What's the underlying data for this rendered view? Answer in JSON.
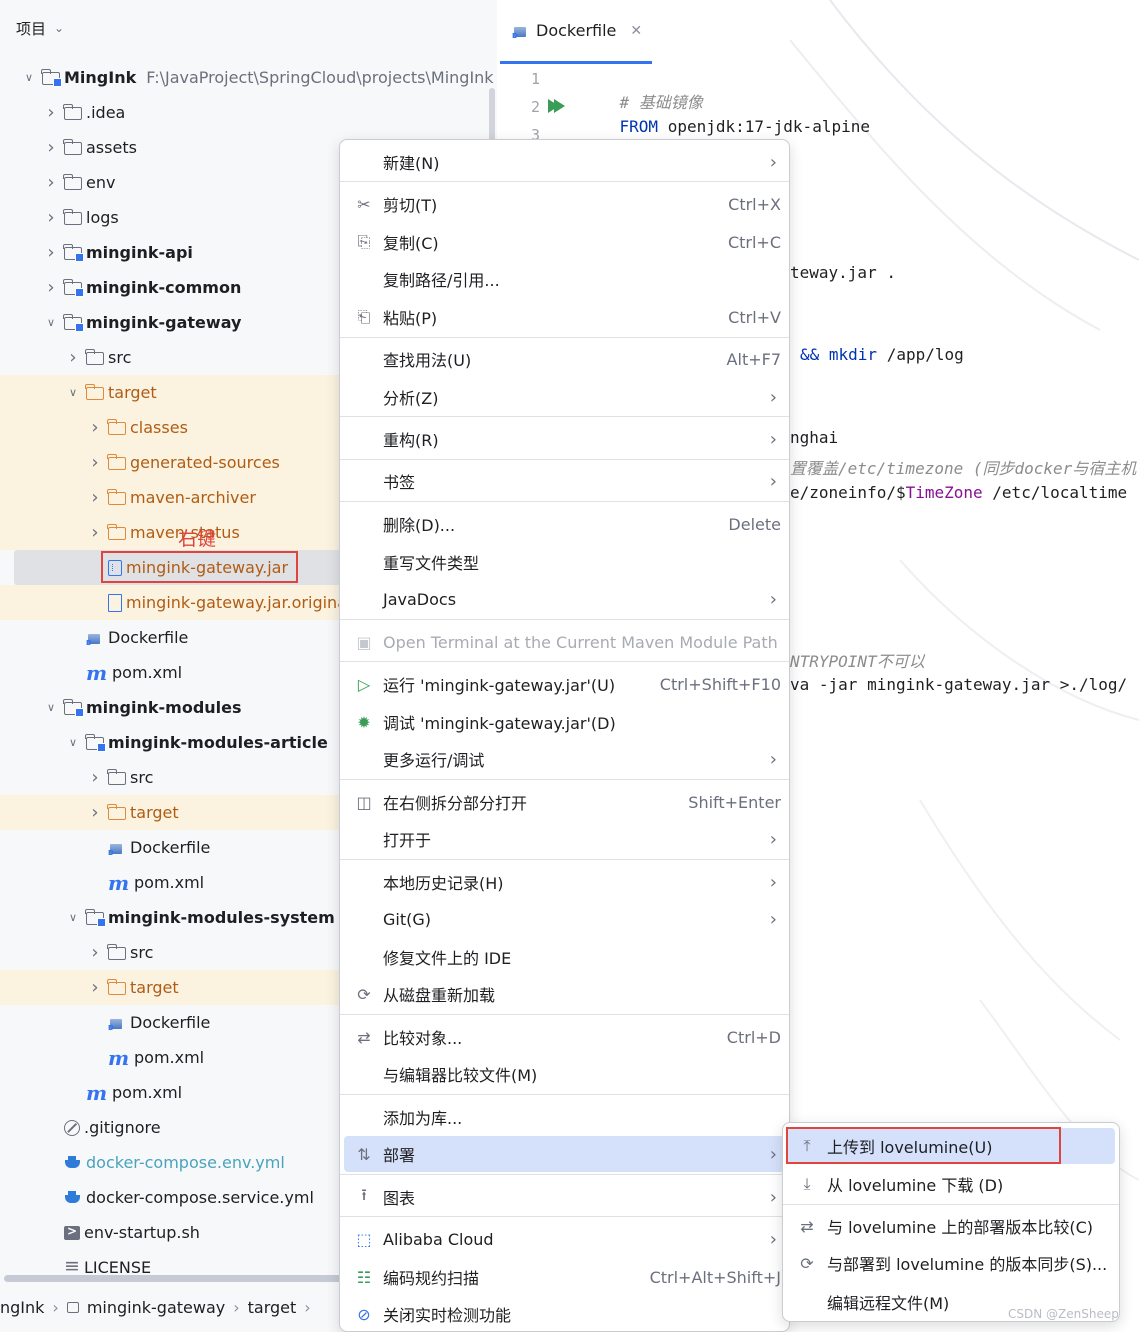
{
  "project_panel": {
    "title": "项目",
    "tree": [
      {
        "label": "MingInk",
        "path": "F:\\JavaProject\\SpringCloud\\projects\\MingInk",
        "type": "module",
        "depth": 1,
        "arrow": "open",
        "bold": true
      },
      {
        "label": ".idea",
        "type": "folder",
        "depth": 2,
        "arrow": "closed"
      },
      {
        "label": "assets",
        "type": "folder",
        "depth": 2,
        "arrow": "closed"
      },
      {
        "label": "env",
        "type": "folder",
        "depth": 2,
        "arrow": "closed"
      },
      {
        "label": "logs",
        "type": "folder",
        "depth": 2,
        "arrow": "closed"
      },
      {
        "label": "mingink-api",
        "type": "module",
        "depth": 2,
        "arrow": "closed",
        "bold": true
      },
      {
        "label": "mingink-common",
        "type": "module",
        "depth": 2,
        "arrow": "closed",
        "bold": true
      },
      {
        "label": "mingink-gateway",
        "type": "module",
        "depth": 2,
        "arrow": "open",
        "bold": true
      },
      {
        "label": "src",
        "type": "folder",
        "depth": 3,
        "arrow": "closed"
      },
      {
        "label": "target",
        "type": "folder-orange",
        "depth": 3,
        "arrow": "open",
        "excluded": true
      },
      {
        "label": "classes",
        "type": "folder-orange",
        "depth": 4,
        "arrow": "closed",
        "excluded": true
      },
      {
        "label": "generated-sources",
        "type": "folder-orange",
        "depth": 4,
        "arrow": "closed",
        "excluded": true
      },
      {
        "label": "maven-archiver",
        "type": "folder-orange",
        "depth": 4,
        "arrow": "closed",
        "excluded": true
      },
      {
        "label": "maven-status",
        "type": "folder-orange",
        "depth": 4,
        "arrow": "closed",
        "excluded": true
      },
      {
        "label": "mingink-gateway.jar",
        "type": "jar",
        "depth": 4,
        "arrow": "none",
        "excluded": true,
        "selected": true
      },
      {
        "label": "mingink-gateway.jar.original",
        "type": "file",
        "depth": 4,
        "arrow": "none",
        "excluded": true
      },
      {
        "label": "Dockerfile",
        "type": "docker",
        "depth": 3,
        "arrow": "none"
      },
      {
        "label": "pom.xml",
        "type": "pom",
        "depth": 3,
        "arrow": "none"
      },
      {
        "label": "mingink-modules",
        "type": "module",
        "depth": 2,
        "arrow": "open",
        "bold": true
      },
      {
        "label": "mingink-modules-article",
        "type": "module",
        "depth": 3,
        "arrow": "open",
        "bold": true
      },
      {
        "label": "src",
        "type": "folder",
        "depth": 4,
        "arrow": "closed"
      },
      {
        "label": "target",
        "type": "folder-orange",
        "depth": 4,
        "arrow": "closed",
        "excluded": true
      },
      {
        "label": "Dockerfile",
        "type": "docker",
        "depth": 4,
        "arrow": "none"
      },
      {
        "label": "pom.xml",
        "type": "pom",
        "depth": 4,
        "arrow": "none"
      },
      {
        "label": "mingink-modules-system",
        "type": "module",
        "depth": 3,
        "arrow": "open",
        "bold": true
      },
      {
        "label": "src",
        "type": "folder",
        "depth": 4,
        "arrow": "closed"
      },
      {
        "label": "target",
        "type": "folder-orange",
        "depth": 4,
        "arrow": "closed",
        "excluded": true
      },
      {
        "label": "Dockerfile",
        "type": "docker",
        "depth": 4,
        "arrow": "none"
      },
      {
        "label": "pom.xml",
        "type": "pom",
        "depth": 4,
        "arrow": "none"
      },
      {
        "label": "pom.xml",
        "type": "pom",
        "depth": 3,
        "arrow": "none"
      },
      {
        "label": ".gitignore",
        "type": "ignore",
        "depth": 2,
        "arrow": "none"
      },
      {
        "label": "docker-compose.env.yml",
        "type": "whale",
        "depth": 2,
        "arrow": "none",
        "teal": true
      },
      {
        "label": "docker-compose.service.yml",
        "type": "whale",
        "depth": 2,
        "arrow": "none"
      },
      {
        "label": "env-startup.sh",
        "type": "sh",
        "depth": 2,
        "arrow": "none"
      },
      {
        "label": "LICENSE",
        "type": "lines",
        "depth": 2,
        "arrow": "none"
      }
    ],
    "annotation": "右键",
    "breadcrumb": [
      "ngInk",
      "mingink-gateway",
      "target"
    ]
  },
  "editor": {
    "tab_label": "Dockerfile",
    "line_numbers": [
      "1",
      "2",
      "3"
    ],
    "lines": [
      {
        "parts": [
          {
            "t": "# 基础镜像",
            "c": "comment"
          }
        ]
      },
      {
        "parts": [
          {
            "t": "FROM",
            "c": "kw"
          },
          {
            "t": " openjdk:17-jdk-alpine",
            "c": ""
          }
        ]
      }
    ],
    "fragments": [
      {
        "t": "teway.jar .",
        "c": ""
      },
      {
        "t": "&& mkdir",
        "c": "kw"
      },
      {
        "t": " /app/log",
        "c": ""
      },
      {
        "t": "nghai",
        "c": ""
      },
      {
        "t": "置覆盖/etc/timezone (同步docker与宿主机",
        "c": "comment"
      },
      {
        "t": "e/zoneinfo/$",
        "c": ""
      },
      {
        "t": "TimeZone",
        "c": "purple"
      },
      {
        "t": " /etc/localtime",
        "c": ""
      },
      {
        "t": "NTRYPOINT不可以",
        "c": "comment"
      },
      {
        "t": "va -jar mingink-gateway.jar >./log/",
        "c": ""
      }
    ]
  },
  "context_menu": {
    "items": [
      {
        "label": "新建(N)",
        "icon": "",
        "shortcut": "",
        "submenu": true
      },
      {
        "label": "剪切(T)",
        "icon": "scissors-icon",
        "shortcut": "Ctrl+X"
      },
      {
        "label": "复制(C)",
        "icon": "copy-icon",
        "shortcut": "Ctrl+C"
      },
      {
        "label": "复制路径/引用...",
        "icon": "",
        "shortcut": ""
      },
      {
        "label": "粘贴(P)",
        "icon": "paste-icon",
        "shortcut": "Ctrl+V"
      },
      {
        "label": "查找用法(U)",
        "icon": "",
        "shortcut": "Alt+F7"
      },
      {
        "label": "分析(Z)",
        "icon": "",
        "shortcut": "",
        "submenu": true
      },
      {
        "label": "重构(R)",
        "icon": "",
        "shortcut": "",
        "submenu": true
      },
      {
        "label": "书签",
        "icon": "",
        "shortcut": "",
        "submenu": true
      },
      {
        "label": "删除(D)...",
        "icon": "",
        "shortcut": "Delete"
      },
      {
        "label": "重写文件类型",
        "icon": "",
        "shortcut": ""
      },
      {
        "label": "JavaDocs",
        "icon": "",
        "shortcut": "",
        "submenu": true
      },
      {
        "label": "Open Terminal at the Current Maven Module Path",
        "icon": "terminal-icon",
        "shortcut": "",
        "disabled": true
      },
      {
        "label": "运行 'mingink-gateway.jar'(U)",
        "icon": "run-icon",
        "shortcut": "Ctrl+Shift+F10"
      },
      {
        "label": "调试 'mingink-gateway.jar'(D)",
        "icon": "debug-icon",
        "shortcut": ""
      },
      {
        "label": "更多运行/调试",
        "icon": "",
        "shortcut": "",
        "submenu": true
      },
      {
        "label": "在右侧拆分部分打开",
        "icon": "split-icon",
        "shortcut": "Shift+Enter"
      },
      {
        "label": "打开于",
        "icon": "",
        "shortcut": "",
        "submenu": true
      },
      {
        "label": "本地历史记录(H)",
        "icon": "",
        "shortcut": "",
        "submenu": true
      },
      {
        "label": "Git(G)",
        "icon": "",
        "shortcut": "",
        "submenu": true
      },
      {
        "label": "修复文件上的 IDE",
        "icon": "",
        "shortcut": ""
      },
      {
        "label": "从磁盘重新加载",
        "icon": "reload-icon",
        "shortcut": ""
      },
      {
        "label": "比较对象...",
        "icon": "compare-icon",
        "shortcut": "Ctrl+D"
      },
      {
        "label": "与编辑器比较文件(M)",
        "icon": "",
        "shortcut": ""
      },
      {
        "label": "添加为库...",
        "icon": "",
        "shortcut": ""
      },
      {
        "label": "部署",
        "icon": "deploy-icon",
        "shortcut": "",
        "submenu": true,
        "active": true
      },
      {
        "label": "图表",
        "icon": "diagram-icon",
        "shortcut": "",
        "submenu": true
      },
      {
        "label": "Alibaba Cloud",
        "icon": "alibaba-cloud-icon",
        "shortcut": "",
        "submenu": true
      },
      {
        "label": "编码规约扫描",
        "icon": "scan-icon",
        "shortcut": "Ctrl+Alt+Shift+J"
      },
      {
        "label": "关闭实时检测功能",
        "icon": "stop-icon",
        "shortcut": ""
      }
    ]
  },
  "deploy_submenu": {
    "items": [
      {
        "label": "上传到 lovelumine(U)",
        "icon": "upload-icon",
        "active": true
      },
      {
        "label": "从 lovelumine 下载 (D)",
        "icon": "download-icon"
      },
      {
        "label": "与 lovelumine 上的部署版本比较(C)",
        "icon": "compare-icon"
      },
      {
        "label": "与部署到 lovelumine 的版本同步(S)...",
        "icon": "sync-icon"
      },
      {
        "label": "编辑远程文件(M)",
        "icon": ""
      }
    ]
  },
  "watermark": "CSDN @ZenSheep"
}
